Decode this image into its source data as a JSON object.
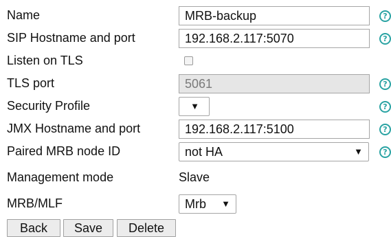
{
  "form": {
    "name": {
      "label": "Name",
      "value": "MRB-backup",
      "help_icon": "help-icon"
    },
    "sip": {
      "label": "SIP Hostname and port",
      "value": "192.168.2.117:5070",
      "help_icon": "help-icon"
    },
    "tls_listen": {
      "label": "Listen on TLS",
      "checked": false
    },
    "tls_port": {
      "label": "TLS port",
      "value": "5061",
      "help_icon": "help-icon"
    },
    "security_profile": {
      "label": "Security Profile",
      "value": "",
      "arrow": "▼",
      "help_icon": "help-icon"
    },
    "jmx": {
      "label": "JMX Hostname and port",
      "value": "192.168.2.117:5100",
      "help_icon": "help-icon"
    },
    "paired_node": {
      "label": "Paired MRB node ID",
      "value": "not HA",
      "arrow": "▼",
      "help_icon": "help-icon"
    },
    "management_mode": {
      "label": "Management mode",
      "value": "Slave"
    },
    "mrb_mlf": {
      "label": "MRB/MLF",
      "value": "Mrb",
      "arrow": "▼"
    }
  },
  "buttons": {
    "back": "Back",
    "save": "Save",
    "delete": "Delete"
  },
  "colors": {
    "help_accent": "#2aa3a3"
  }
}
